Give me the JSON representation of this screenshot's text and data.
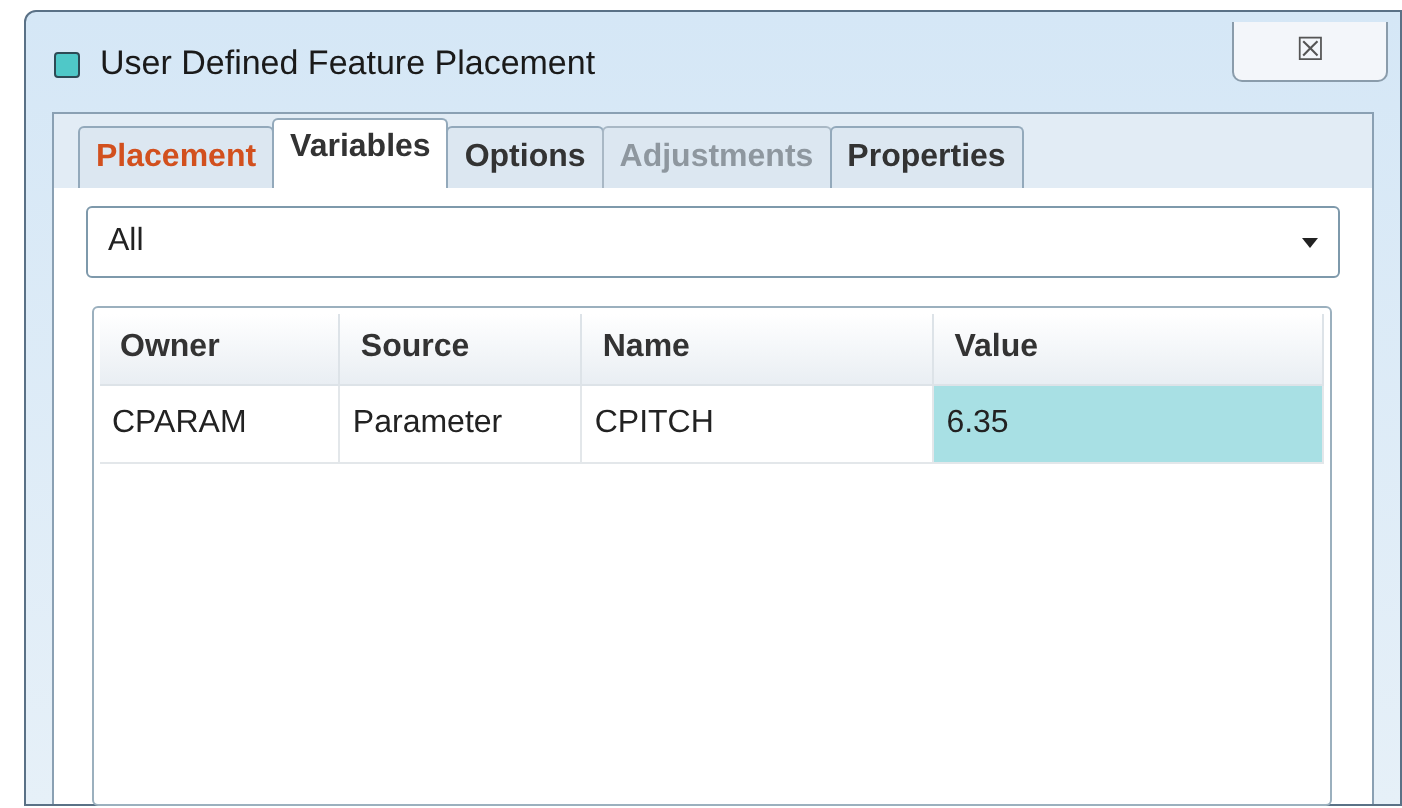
{
  "window": {
    "title": "User Defined Feature Placement",
    "close_glyph": "☒"
  },
  "tabs": [
    {
      "label": "Placement",
      "selected": false,
      "disabled": false,
      "attention": true
    },
    {
      "label": "Variables",
      "selected": true,
      "disabled": false,
      "attention": false
    },
    {
      "label": "Options",
      "selected": false,
      "disabled": false,
      "attention": false
    },
    {
      "label": "Adjustments",
      "selected": false,
      "disabled": true,
      "attention": false
    },
    {
      "label": "Properties",
      "selected": false,
      "disabled": false,
      "attention": false
    }
  ],
  "filter": {
    "value": "All"
  },
  "table": {
    "columns": [
      "Owner",
      "Source",
      "Name",
      "Value"
    ],
    "rows": [
      {
        "cells": [
          {
            "text": "CPARAM",
            "selected": false
          },
          {
            "text": "Parameter",
            "selected": false
          },
          {
            "text": "CPITCH",
            "selected": false
          },
          {
            "text": "6.35",
            "selected": true
          }
        ]
      }
    ]
  }
}
